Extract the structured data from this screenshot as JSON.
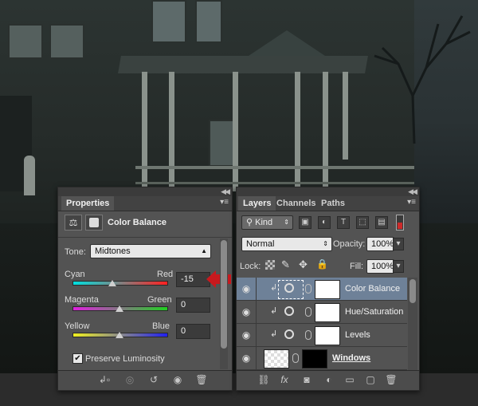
{
  "properties": {
    "tab": "Properties",
    "title": "Color Balance",
    "tone_label": "Tone:",
    "tone_value": "Midtones",
    "sliders": [
      {
        "left": "Cyan",
        "right": "Red",
        "value": "-15",
        "position": 0.42
      },
      {
        "left": "Magenta",
        "right": "Green",
        "value": "0",
        "position": 0.5
      },
      {
        "left": "Yellow",
        "right": "Blue",
        "value": "0",
        "position": 0.5
      }
    ],
    "preserve_label": "Preserve Luminosity",
    "preserve_checked": true
  },
  "layers": {
    "tabs": [
      "Layers",
      "Channels",
      "Paths"
    ],
    "filter_kind": "Kind",
    "blend_mode": "Normal",
    "opacity_label": "Opacity:",
    "opacity_value": "100%",
    "lock_label": "Lock:",
    "fill_label": "Fill:",
    "fill_value": "100%",
    "rows": [
      {
        "name": "Color Balance",
        "selected": true
      },
      {
        "name": "Hue/Saturation",
        "selected": false
      },
      {
        "name": "Levels",
        "selected": false
      },
      {
        "name": "Windows",
        "selected": false
      }
    ]
  },
  "colors": {
    "panel_bg": "#535353",
    "selected_row": "#6e8198",
    "arrow_red": "#c8191e"
  }
}
